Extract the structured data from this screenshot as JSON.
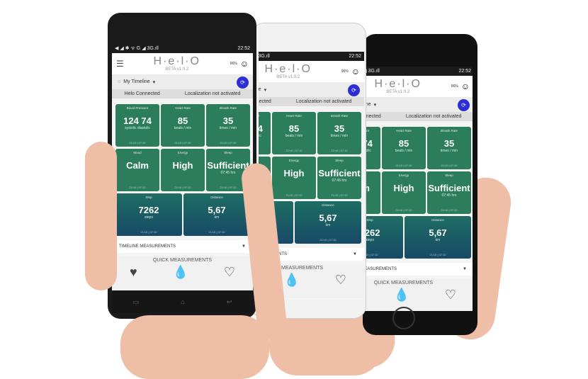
{
  "status": {
    "signal": "◀ ◢ ✱ ᯤ G ◢ 3G.ıll",
    "time": "22:52",
    "time_mid": "22:52",
    "time_back": "22:52"
  },
  "header": {
    "logo": "H·e·l·O",
    "version": "BETA v1.0.2",
    "battery": "96%"
  },
  "timeline": {
    "label": "My Timeline"
  },
  "connection": {
    "helo": "Helo Connected",
    "location": "Localization not activated"
  },
  "tiles": [
    {
      "title": "Blood Pressure",
      "value": "124  74",
      "unit": "systolic   diastolic",
      "date": "21/10 | 07:32"
    },
    {
      "title": "Heart Rate",
      "value": "85",
      "unit": "beats / min",
      "date": "21/10 | 07:32"
    },
    {
      "title": "Breath Rate",
      "value": "35",
      "unit": "times / min",
      "date": "21/10 | 07:32"
    },
    {
      "title": "Mood",
      "value": "Calm",
      "unit": "",
      "date": "21/10 | 07:32"
    },
    {
      "title": "Energy",
      "value": "High",
      "unit": "",
      "date": "21/10 | 07:32"
    },
    {
      "title": "Sleep",
      "value": "Sufficient",
      "unit": "07:45 hrs",
      "date": "21/10 | 07:32"
    },
    {
      "title": "Step",
      "value": "7262",
      "unit": "steps",
      "date": "21/10 | 07:32"
    },
    {
      "title": "Distance",
      "value": "5,67",
      "unit": "km",
      "date": "21/10 | 07:32"
    }
  ],
  "timeline_measurements": "TIMELINE MEASUREMENTS",
  "quick_measurements": "QUICK MEASUREMENTS"
}
